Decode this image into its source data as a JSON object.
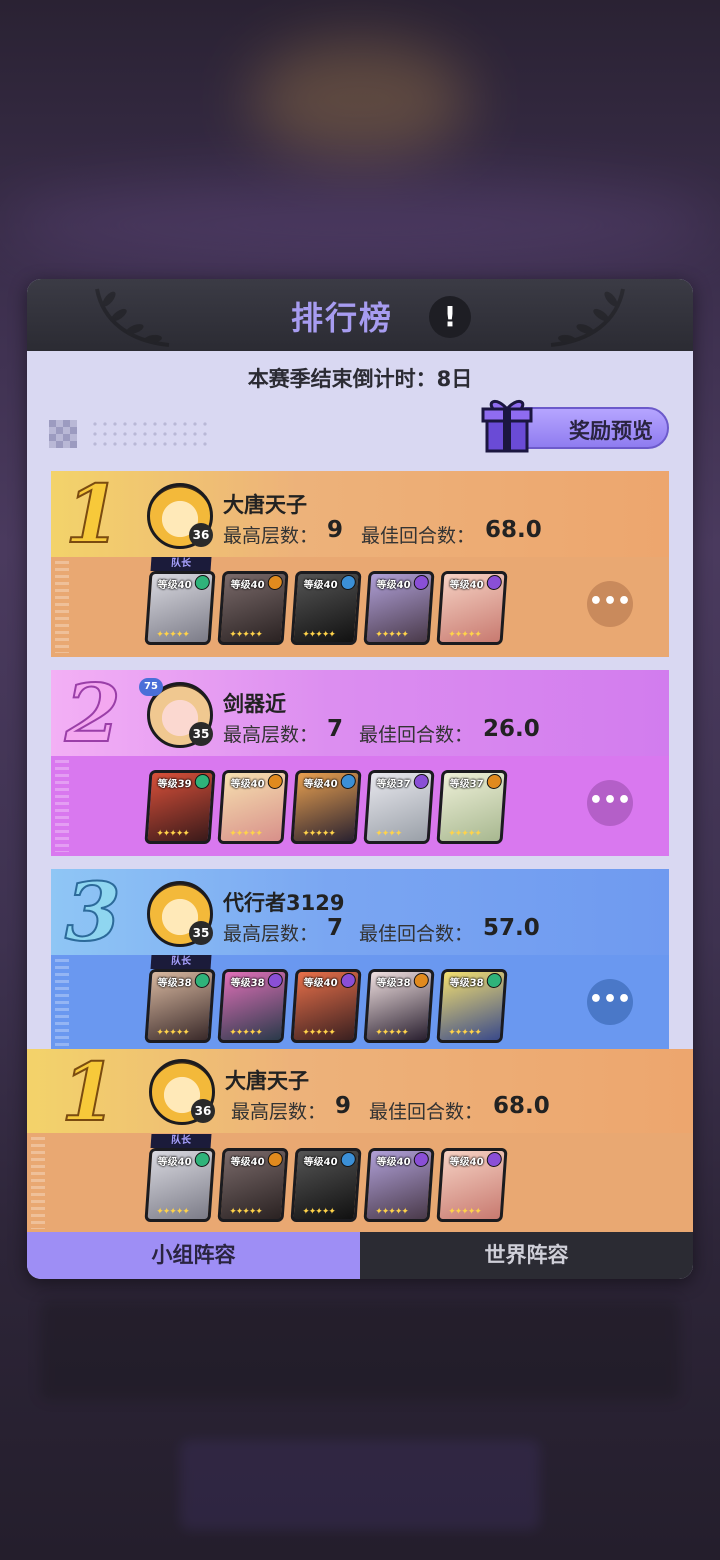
{
  "leaderboard": {
    "title": "排行榜",
    "info_icon": "!",
    "countdown": "本赛季结束倒计时：8日",
    "reward_button": "奖励预览",
    "stat_labels": {
      "max_floor": "最高层数：",
      "best_rounds": "最佳回合数："
    },
    "captain_tag": "队长",
    "more_icon": "•••",
    "entries": [
      {
        "rank": "1",
        "name": "大唐天子",
        "avatar_level": "36",
        "vip": "",
        "max_floor": "9",
        "best_rounds": "68.0",
        "heroes": [
          {
            "level": "等级40",
            "element": "#2fb37a",
            "stars": "✦✦✦✦✦"
          },
          {
            "level": "等级40",
            "element": "#e08a1e",
            "stars": "✦✦✦✦✦"
          },
          {
            "level": "等级40",
            "element": "#3b8fd6",
            "stars": "✦✦✦✦✦"
          },
          {
            "level": "等级40",
            "element": "#8a4fd6",
            "stars": "✦✦✦✦✦"
          },
          {
            "level": "等级40",
            "element": "#8a4fd6",
            "stars": "✦✦✦✦✦"
          }
        ]
      },
      {
        "rank": "2",
        "name": "剑器近",
        "avatar_level": "35",
        "vip": "75",
        "max_floor": "7",
        "best_rounds": "26.0",
        "heroes": [
          {
            "level": "等级39",
            "element": "#2fb37a",
            "stars": "✦✦✦✦✦"
          },
          {
            "level": "等级40",
            "element": "#e08a1e",
            "stars": "✦✦✦✦✦"
          },
          {
            "level": "等级40",
            "element": "#3b8fd6",
            "stars": "✦✦✦✦✦"
          },
          {
            "level": "等级37",
            "element": "#8a4fd6",
            "stars": "✦✦✦✦"
          },
          {
            "level": "等级37",
            "element": "#e08a1e",
            "stars": "✦✦✦✦✦"
          }
        ]
      },
      {
        "rank": "3",
        "name": "代行者3129",
        "avatar_level": "35",
        "vip": "",
        "max_floor": "7",
        "best_rounds": "57.0",
        "heroes": [
          {
            "level": "等级38",
            "element": "#2fb37a",
            "stars": "✦✦✦✦✦"
          },
          {
            "level": "等级38",
            "element": "#8a4fd6",
            "stars": "✦✦✦✦✦"
          },
          {
            "level": "等级40",
            "element": "#8a4fd6",
            "stars": "✦✦✦✦✦"
          },
          {
            "level": "等级38",
            "element": "#e08a1e",
            "stars": "✦✦✦✦✦"
          },
          {
            "level": "等级38",
            "element": "#2fb37a",
            "stars": "✦✦✦✦✦"
          }
        ]
      },
      {
        "rank": "1",
        "name": "大唐天子",
        "avatar_level": "36",
        "vip": "",
        "max_floor": "9",
        "best_rounds": "68.0",
        "heroes": [
          {
            "level": "等级40",
            "element": "#2fb37a",
            "stars": "✦✦✦✦✦"
          },
          {
            "level": "等级40",
            "element": "#e08a1e",
            "stars": "✦✦✦✦✦"
          },
          {
            "level": "等级40",
            "element": "#3b8fd6",
            "stars": "✦✦✦✦✦"
          },
          {
            "level": "等级40",
            "element": "#8a4fd6",
            "stars": "✦✦✦✦✦"
          },
          {
            "level": "等级40",
            "element": "#8a4fd6",
            "stars": "✦✦✦✦✦"
          }
        ]
      }
    ],
    "tabs": {
      "group": "小组阵容",
      "world": "世界阵容"
    }
  }
}
